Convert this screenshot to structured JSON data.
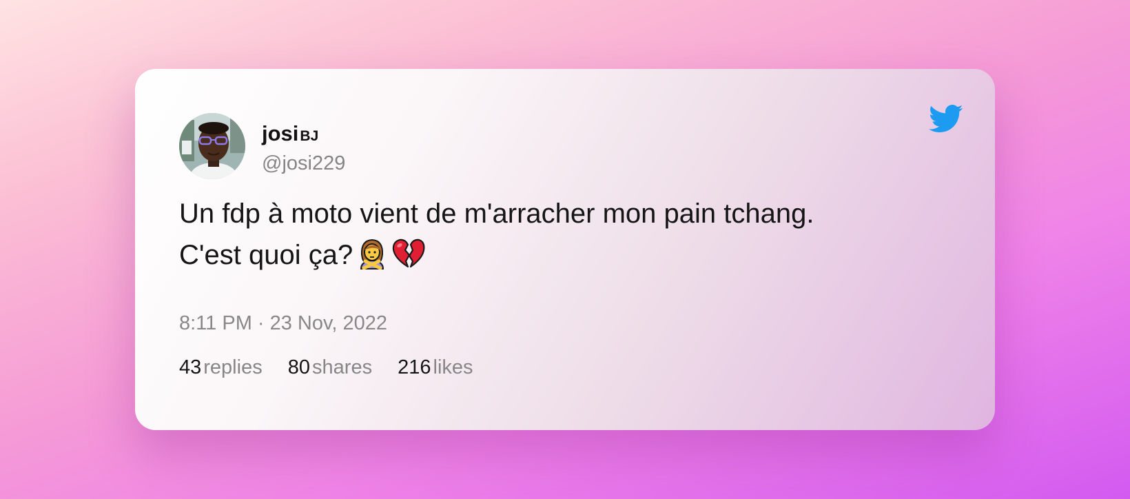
{
  "card": {
    "author": {
      "display_name": "josi",
      "display_name_suffix": "BJ",
      "handle": "@josi229",
      "avatar_icon": "profile-photo-avatar"
    },
    "brand_icon": "twitter-bird-icon",
    "brand_color": "#1d9bf0",
    "text_lines": [
      "Un fdp à moto vient de m'arracher mon pain tchang.",
      "C'est quoi ça?"
    ],
    "text_emojis": [
      "woman-gesturing-no-emoji",
      "broken-heart-emoji"
    ],
    "timestamp": "8:11 PM · 23 Nov, 2022",
    "stats": {
      "replies": {
        "count": "43",
        "label": "replies"
      },
      "shares": {
        "count": "80",
        "label": "shares"
      },
      "likes": {
        "count": "216",
        "label": "likes"
      }
    }
  }
}
